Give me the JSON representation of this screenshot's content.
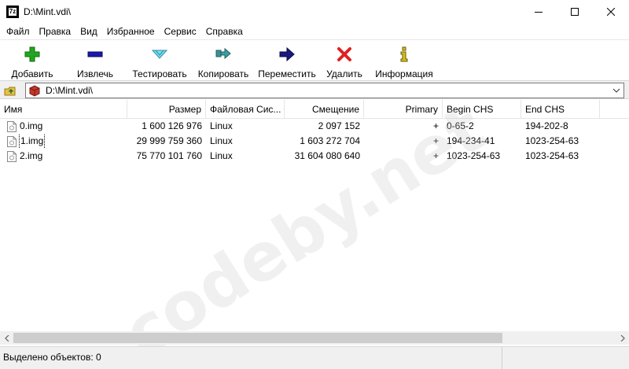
{
  "window": {
    "title": "D:\\Mint.vdi\\",
    "app_icon_text": "7z"
  },
  "menu": {
    "items": [
      "Файл",
      "Правка",
      "Вид",
      "Избранное",
      "Сервис",
      "Справка"
    ]
  },
  "toolbar": {
    "buttons": [
      {
        "label": "Добавить",
        "icon": "add-icon",
        "color": "#22a622"
      },
      {
        "label": "Извлечь",
        "icon": "extract-icon",
        "color": "#1a1aa8"
      },
      {
        "label": "Тестировать",
        "icon": "test-icon",
        "color": "#3fbfd8"
      },
      {
        "label": "Копировать",
        "icon": "copy-icon",
        "color": "#2a7f7f"
      },
      {
        "label": "Переместить",
        "icon": "move-icon",
        "color": "#1a1a80"
      },
      {
        "label": "Удалить",
        "icon": "delete-icon",
        "color": "#e02020"
      },
      {
        "label": "Информация",
        "icon": "info-icon",
        "color": "#d8c020"
      }
    ]
  },
  "address": {
    "path": "D:\\Mint.vdi\\"
  },
  "table": {
    "columns": [
      "Имя",
      "Размер",
      "Файловая Сис...",
      "Смещение",
      "Primary",
      "Begin CHS",
      "End CHS"
    ],
    "rows": [
      {
        "name": "0.img",
        "size": "1 600 126 976",
        "fs": "Linux",
        "offset": "2 097 152",
        "primary": "+",
        "begin_chs": "0-65-2",
        "end_chs": "194-202-8"
      },
      {
        "name": "1.img",
        "size": "29 999 759 360",
        "fs": "Linux",
        "offset": "1 603 272 704",
        "primary": "+",
        "begin_chs": "194-234-41",
        "end_chs": "1023-254-63"
      },
      {
        "name": "2.img",
        "size": "75 770 101 760",
        "fs": "Linux",
        "offset": "31 604 080 640",
        "primary": "+",
        "begin_chs": "1023-254-63",
        "end_chs": "1023-254-63"
      }
    ]
  },
  "status": {
    "text": "Выделено объектов: 0"
  },
  "watermark": {
    "text": "codeby.net"
  }
}
